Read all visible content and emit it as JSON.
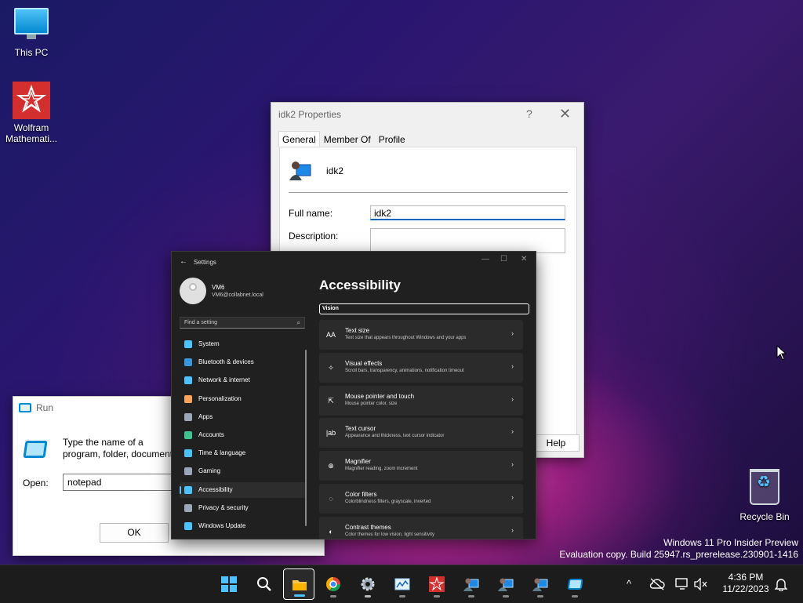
{
  "desktop": {
    "icons": [
      {
        "label": "This PC"
      },
      {
        "label": "Wolfram Mathemati..."
      },
      {
        "label": "Recycle Bin"
      }
    ],
    "watermark_line1": "Windows 11 Pro Insider Preview",
    "watermark_line2": "Evaluation copy. Build 25947.rs_prerelease.230901-1416"
  },
  "props": {
    "title": "idk2 Properties",
    "help_glyph": "?",
    "close_glyph": "✕",
    "tabs": [
      "General",
      "Member Of",
      "Profile"
    ],
    "user_name": "idk2",
    "full_name_label": "Full name:",
    "full_name_value": "idk2",
    "description_label": "Description:",
    "description_value": "",
    "help_button": "Help"
  },
  "run": {
    "title": "Run",
    "message": "Type the name of a program, folder, document, or Internet resource, and Windows will open it for you.",
    "open_label": "Open:",
    "open_value": "notepad",
    "ok_button": "OK"
  },
  "settings": {
    "title": "Settings",
    "account_name": "VM6",
    "account_email": "VM6@collabnet.local",
    "search_placeholder": "Find a setting",
    "nav": [
      {
        "label": "System",
        "color": "#4cc2ff"
      },
      {
        "label": "Bluetooth & devices",
        "color": "#3a96dd"
      },
      {
        "label": "Network & internet",
        "color": "#4cc2ff"
      },
      {
        "label": "Personalization",
        "color": "#f7a35c"
      },
      {
        "label": "Apps",
        "color": "#9aa7b8"
      },
      {
        "label": "Accounts",
        "color": "#3fc48f"
      },
      {
        "label": "Time & language",
        "color": "#4cc2ff"
      },
      {
        "label": "Gaming",
        "color": "#9aa7b8"
      },
      {
        "label": "Accessibility",
        "color": "#4cc2ff"
      },
      {
        "label": "Privacy & security",
        "color": "#9aa7b8"
      },
      {
        "label": "Windows Update",
        "color": "#4cc2ff"
      }
    ],
    "active_nav": "Accessibility",
    "heading": "Accessibility",
    "section": "Vision",
    "cards": [
      {
        "title": "Text size",
        "subtitle": "Text size that appears throughout Windows and your apps",
        "icon": "AA"
      },
      {
        "title": "Visual effects",
        "subtitle": "Scroll bars, transparency, animations, notification timeout",
        "icon": "✧"
      },
      {
        "title": "Mouse pointer and touch",
        "subtitle": "Mouse pointer color, size",
        "icon": "⇱"
      },
      {
        "title": "Text cursor",
        "subtitle": "Appearance and thickness, text cursor indicator",
        "icon": "|ab"
      },
      {
        "title": "Magnifier",
        "subtitle": "Magnifier reading, zoom increment",
        "icon": "⊕"
      },
      {
        "title": "Color filters",
        "subtitle": "Colorblindness filters, grayscale, inverted",
        "icon": "◌"
      },
      {
        "title": "Contrast themes",
        "subtitle": "Color themes for low vision, light sensitivity",
        "icon": "◐"
      }
    ]
  },
  "taskbar": {
    "time": "4:36 PM",
    "date": "11/22/2023",
    "tray_chevron": "^"
  },
  "colors": {
    "accent": "#4cc2ff",
    "settings_bg": "#202020",
    "card_bg": "#2b2b2b"
  }
}
